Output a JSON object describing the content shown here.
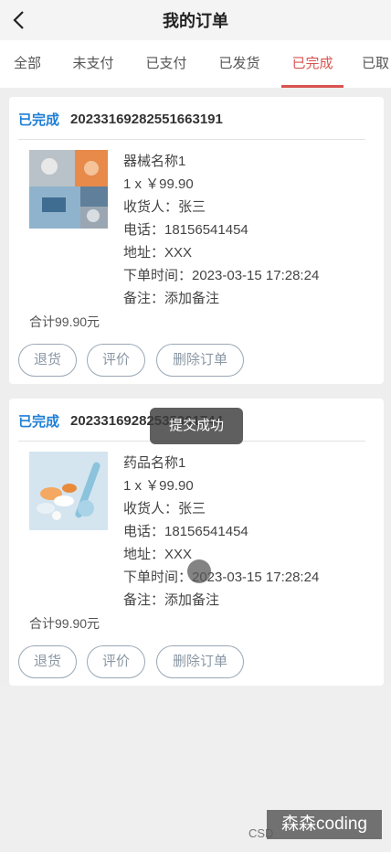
{
  "header": {
    "title": "我的订单",
    "back_icon": "chevron-left-icon"
  },
  "tabs": [
    {
      "label": "全部"
    },
    {
      "label": "未支付"
    },
    {
      "label": "已支付"
    },
    {
      "label": "已发货"
    },
    {
      "label": "已完成",
      "active": true
    },
    {
      "label": "已取"
    }
  ],
  "orders": [
    {
      "status": "已完成",
      "order_no": "20233169282551663191",
      "product_name": "器械名称1",
      "qty_price": "1 x ￥99.90",
      "receiver": "收货人：张三",
      "phone": "电话：18156541454",
      "address": "地址：XXX",
      "order_time": "下单时间：2023-03-15 17:28:24",
      "remark": "备注：添加备注",
      "total": "合计99.90元",
      "buttons": {
        "return": "退货",
        "review": "评价",
        "delete": "删除订单"
      }
    },
    {
      "status": "已完成",
      "order_no": "20233169282535961744",
      "product_name": "药品名称1",
      "qty_price": "1 x ￥99.90",
      "receiver": "收货人：张三",
      "phone": "电话：18156541454",
      "address": "地址：XXX",
      "order_time": "下单时间：2023-03-15 17:28:24",
      "remark": "备注：添加备注",
      "total": "合计99.90元",
      "buttons": {
        "return": "退货",
        "review": "评价",
        "delete": "删除订单"
      }
    }
  ],
  "toast": {
    "text": "提交成功"
  },
  "watermark": {
    "small": "CSD",
    "big": "森森coding"
  },
  "colors": {
    "accent": "#d9534f",
    "status": "#1e7fd6",
    "button_border": "#9aa8b5"
  }
}
